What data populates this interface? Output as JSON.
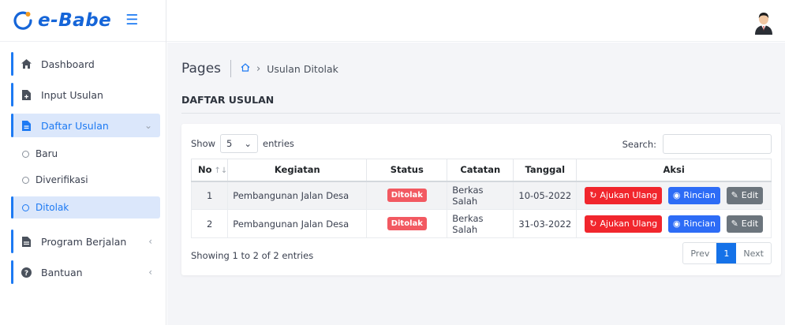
{
  "app": {
    "name": "e-Babe"
  },
  "colors": {
    "primary": "#1d7af3",
    "danger": "#f1262d",
    "info": "#2d6cf6",
    "secondary": "#6c757d",
    "active_bg": "#dbe7fb"
  },
  "sidebar": {
    "items": [
      {
        "label": "Dashboard",
        "icon": "home-icon"
      },
      {
        "label": "Input Usulan",
        "icon": "file-plus-icon"
      },
      {
        "label": "Daftar Usulan",
        "icon": "file-text-icon"
      }
    ],
    "sub_items": [
      {
        "label": "Baru"
      },
      {
        "label": "Diverifikasi"
      },
      {
        "label": "Ditolak"
      }
    ],
    "bottom_items": [
      {
        "label": "Program Berjalan",
        "icon": "document-icon"
      },
      {
        "label": "Bantuan",
        "icon": "help-icon"
      }
    ]
  },
  "breadcrumb": {
    "root": "Pages",
    "current": "Usulan Ditolak"
  },
  "section": {
    "title": "DAFTAR USULAN"
  },
  "table": {
    "length_prefix": "Show",
    "length_value": "5",
    "length_suffix": "entries",
    "search_label": "Search:",
    "search_value": "",
    "columns": [
      "No",
      "Kegiatan",
      "Status",
      "Catatan",
      "Tanggal",
      "Aksi"
    ],
    "rows": [
      {
        "no": "1",
        "kegiatan": "Pembangunan Jalan Desa",
        "status": "Ditolak",
        "catatan": "Berkas Salah",
        "tanggal": "10-05-2022"
      },
      {
        "no": "2",
        "kegiatan": "Pembangunan Jalan Desa",
        "status": "Ditolak",
        "catatan": "Berkas Salah",
        "tanggal": "31-03-2022"
      }
    ],
    "actions": {
      "resubmit": "Ajukan Ulang",
      "detail": "Rincian",
      "edit": "Edit"
    },
    "info": "Showing 1 to 2 of 2 entries",
    "pagination": {
      "prev": "Prev",
      "page": "1",
      "next": "Next"
    }
  }
}
